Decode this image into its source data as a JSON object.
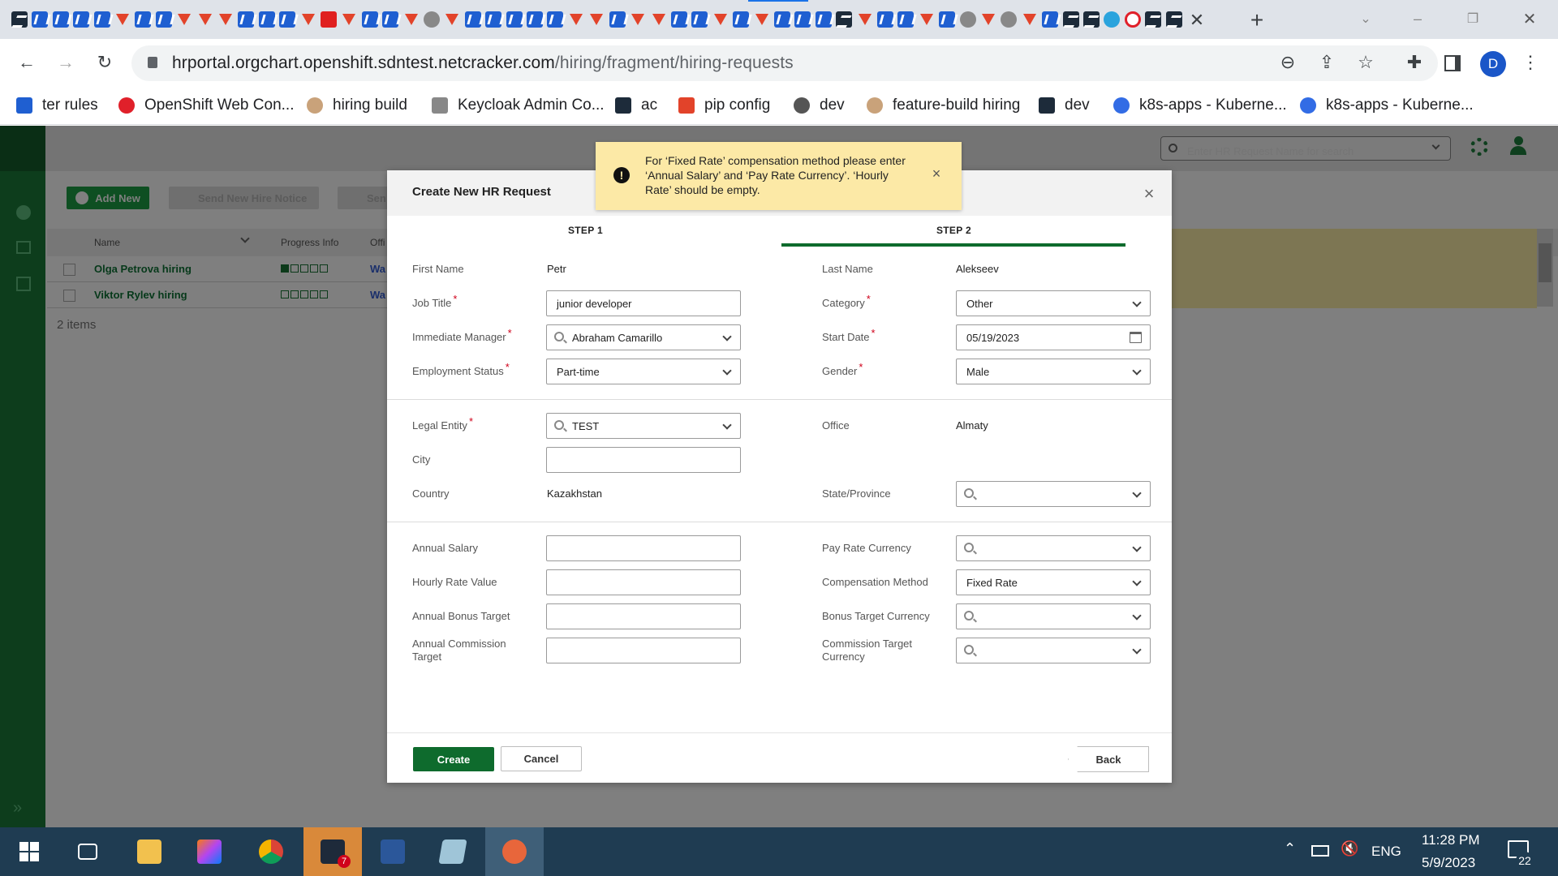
{
  "browser": {
    "url_host": "hrportal.orgchart.openshift.sdntest.netcracker.com",
    "url_path": "/hiring/fragment/hiring-requests",
    "profile_initial": "D",
    "bookmarks": [
      {
        "label": "ter rules",
        "icon": "confluence-icon",
        "color": "#1f5fd1"
      },
      {
        "label": "OpenShift Web Con...",
        "icon": "openshift-icon",
        "color": "#e0202a"
      },
      {
        "label": "hiring build",
        "icon": "jenkins-icon",
        "color": "#c9a27a"
      },
      {
        "label": "Keycloak Admin Co...",
        "icon": "keycloak-icon",
        "color": "#888888"
      },
      {
        "label": "ac",
        "icon": "argocd-icon",
        "color": "#1d2b3a"
      },
      {
        "label": "pip config",
        "icon": "gitlab-icon",
        "color": "#e2432a"
      },
      {
        "label": "dev",
        "icon": "globe-icon",
        "color": "#555555"
      },
      {
        "label": "feature-build hiring",
        "icon": "jenkins-icon",
        "color": "#c9a27a"
      },
      {
        "label": "dev",
        "icon": "argocd-icon",
        "color": "#1d2b3a"
      },
      {
        "label": "k8s-apps - Kuberne...",
        "icon": "kubernetes-icon",
        "color": "#326ce5"
      },
      {
        "label": "k8s-apps - Kuberne...",
        "icon": "kubernetes-icon",
        "color": "#326ce5"
      }
    ]
  },
  "app": {
    "search_placeholder": "Enter HR Request Name for search",
    "toolbar": {
      "add_new": "Add New",
      "send_notice": "Send New Hire Notice",
      "send_other": "Sen"
    },
    "columns": {
      "name": "Name",
      "progress": "Progress Info",
      "office": "Offi"
    },
    "rows": [
      {
        "name": "Olga Petrova hiring",
        "office": "Wa",
        "progress_filled": 1,
        "progress_total": 5
      },
      {
        "name": "Viktor Rylev hiring",
        "office": "Wa",
        "progress_filled": 0,
        "progress_total": 5
      }
    ],
    "items_count": "2 items"
  },
  "toast": {
    "message": "For ‘Fixed Rate’ compensation method please enter ‘Annual Salary’ and ‘Pay Rate Currency’. ‘Hourly Rate’ should be empty.",
    "icon": "exclamation-icon"
  },
  "modal": {
    "title": "Create New HR Request",
    "step1": "STEP 1",
    "step2": "STEP 2",
    "fields": {
      "first_name_label": "First Name",
      "first_name": "Petr",
      "last_name_label": "Last Name",
      "last_name": "Alekseev",
      "job_title_label": "Job Title",
      "job_title": "junior developer",
      "category_label": "Category",
      "category": "Other",
      "manager_label": "Immediate Manager",
      "manager": "Abraham Camarillo",
      "start_date_label": "Start Date",
      "start_date": "05/19/2023",
      "employment_label": "Employment Status",
      "employment": "Part-time",
      "gender_label": "Gender",
      "gender": "Male",
      "legal_entity_label": "Legal Entity",
      "legal_entity": "TEST",
      "office_label": "Office",
      "office": "Almaty",
      "city_label": "City",
      "city": "",
      "country_label": "Country",
      "country": "Kazakhstan",
      "state_label": "State/Province",
      "state": "",
      "annual_salary_label": "Annual Salary",
      "annual_salary": "",
      "pay_currency_label": "Pay Rate Currency",
      "pay_currency": "",
      "hourly_label": "Hourly Rate Value",
      "hourly": "",
      "comp_method_label": "Compensation Method",
      "comp_method": "Fixed Rate",
      "bonus_label": "Annual Bonus Target",
      "bonus": "",
      "bonus_currency_label": "Bonus Target Currency",
      "bonus_currency": "",
      "commission_label": "Annual Commission Target",
      "commission": "",
      "commission_currency_label": "Commission Target Currency",
      "commission_currency": ""
    },
    "buttons": {
      "create": "Create",
      "cancel": "Cancel",
      "back": "Back"
    }
  },
  "taskbar": {
    "language": "ENG",
    "time": "11:28 PM",
    "date": "5/9/2023",
    "notification_count": "22",
    "webstorm_badge": "7"
  },
  "colors": {
    "accent_green": "#0e6b2d",
    "toast_bg": "#fce9a6",
    "required": "#d0021b"
  }
}
